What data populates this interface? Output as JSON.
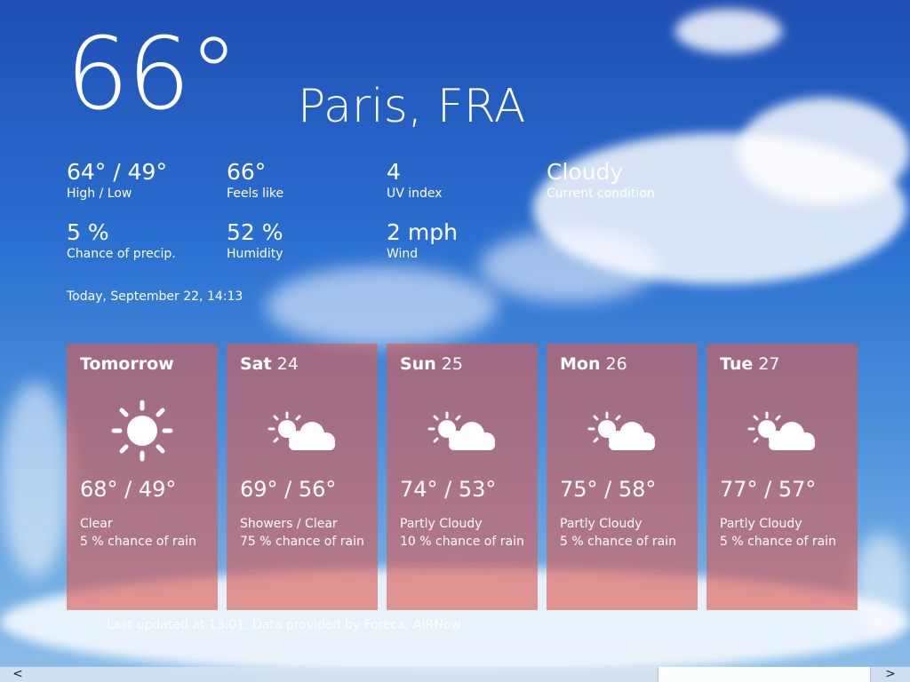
{
  "current": {
    "temperature": "66°",
    "city": "Paris, FRA"
  },
  "details": [
    {
      "value": "64° / 49°",
      "label": "High / Low"
    },
    {
      "value": "66°",
      "label": "Feels like"
    },
    {
      "value": "4",
      "label": "UV index"
    },
    {
      "value": "Cloudy",
      "label": "Current condition"
    },
    {
      "value": "5 %",
      "label": "Chance of precip."
    },
    {
      "value": "52 %",
      "label": "Humidity"
    },
    {
      "value": "2 mph",
      "label": "Wind"
    }
  ],
  "timestamp": "Today, September 22, 14:13",
  "forecast": [
    {
      "day_bold": "Tomorrow",
      "day_num": "",
      "icon": "sun-icon",
      "temps": "68° / 49°",
      "condition": "Clear",
      "rain": "5 % chance of rain"
    },
    {
      "day_bold": "Sat",
      "day_num": " 24",
      "icon": "partly-cloudy-icon",
      "temps": "69° / 56°",
      "condition": "Showers / Clear",
      "rain": "75 % chance of rain"
    },
    {
      "day_bold": "Sun",
      "day_num": " 25",
      "icon": "partly-cloudy-icon",
      "temps": "74° / 53°",
      "condition": "Partly Cloudy",
      "rain": "10 % chance of rain"
    },
    {
      "day_bold": "Mon",
      "day_num": " 26",
      "icon": "partly-cloudy-icon",
      "temps": "75° / 58°",
      "condition": "Partly Cloudy",
      "rain": "5 % chance of rain"
    },
    {
      "day_bold": "Tue",
      "day_num": " 27",
      "icon": "partly-cloudy-icon",
      "temps": "77° / 57°",
      "condition": "Partly Cloudy",
      "rain": "5 % chance of rain"
    }
  ],
  "footer": "Last updated at 13:01. Data provided by Foreca, AIRNow",
  "scrollbar": {
    "left_arrow": "<",
    "right_arrow": ">"
  },
  "colors": {
    "card": "#dc5a50",
    "sky_top": "#1f4fb3",
    "sky_bottom": "#8ec0ea"
  }
}
